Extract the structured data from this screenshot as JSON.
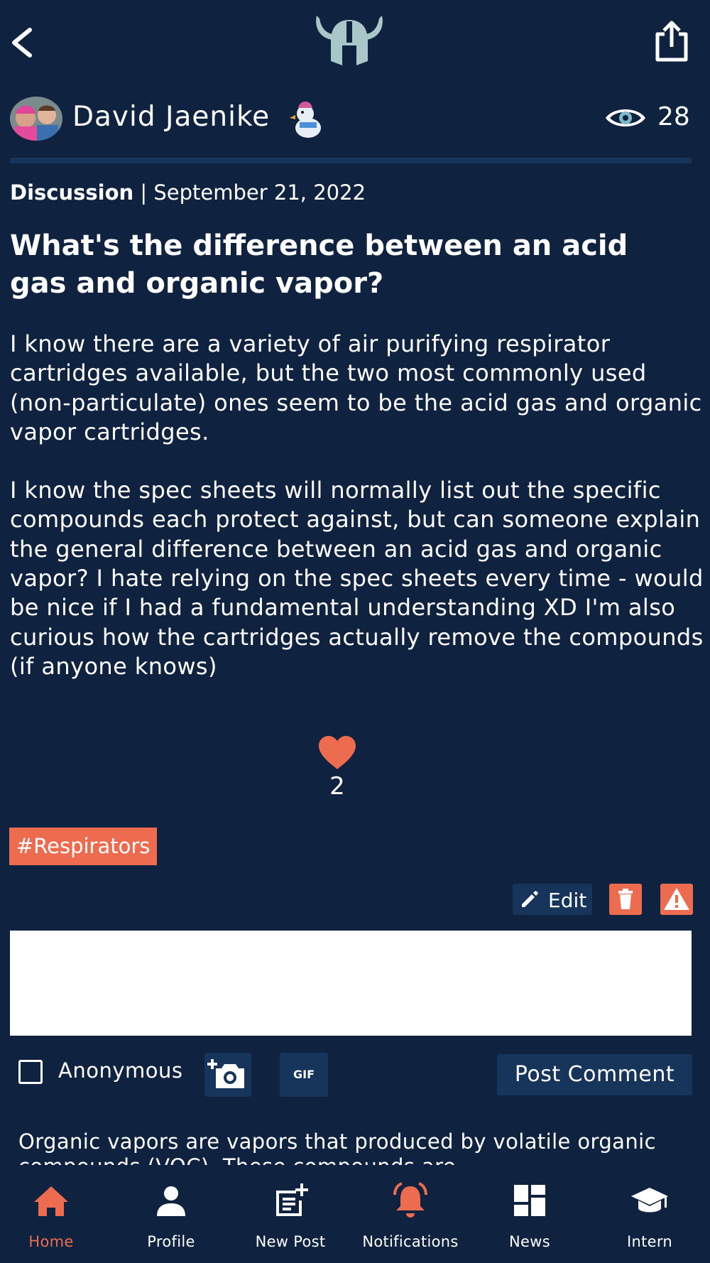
{
  "header": {
    "back_icon": "chevron-left-icon",
    "logo_icon": "viking-helmet-logo",
    "share_icon": "share-icon"
  },
  "author": {
    "name": "David Jaenike",
    "badge_icon": "duck-badge-icon",
    "views": "28"
  },
  "post": {
    "type": "Discussion",
    "separator": " | ",
    "date": "September 21, 2022",
    "title": "What's the difference between an acid gas and organic vapor?",
    "paragraph1": "I know there are a variety of air purifying respirator cartridges available, but the two most commonly used (non-particulate) ones seem to be the acid gas and organic vapor cartridges.",
    "paragraph2": "I know the spec sheets will normally list out the specific compounds each protect against, but can someone explain the general difference between an acid gas and organic vapor? I hate relying on the spec sheets every time - would be nice if I had a fundamental understanding XD I'm also curious how the cartridges actually remove the compounds (if anyone knows)",
    "likes": "2",
    "tag": "#Respirators"
  },
  "actions": {
    "edit_label": "Edit"
  },
  "comment_form": {
    "anonymous_label": "Anonymous",
    "gif_label": "GIF",
    "post_label": "Post Comment"
  },
  "comments": {
    "preview": "Organic vapors are vapors that produced by volatile organic compounds (VOC). These compounds are"
  },
  "colors": {
    "background": "#0f2340",
    "accent": "#ed6b4f",
    "button_bg": "#17345b"
  },
  "tabs": [
    {
      "label": "Home",
      "icon": "home-icon",
      "active": true
    },
    {
      "label": "Profile",
      "icon": "person-icon",
      "active": false
    },
    {
      "label": "New Post",
      "icon": "new-post-icon",
      "active": false
    },
    {
      "label": "Notifications",
      "icon": "bell-icon",
      "active": false
    },
    {
      "label": "News",
      "icon": "dashboard-icon",
      "active": false
    },
    {
      "label": "Intern",
      "icon": "graduation-cap-icon",
      "active": false
    }
  ]
}
